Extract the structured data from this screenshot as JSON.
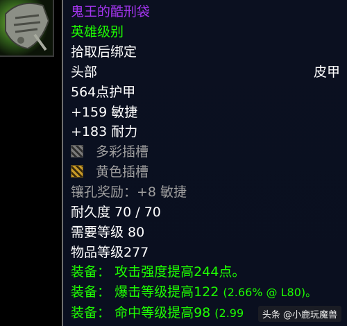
{
  "item": {
    "name": "鬼王的酷刑袋",
    "quality": "英雄级别",
    "bind": "拾取后绑定",
    "slot": "头部",
    "armor_type": "皮甲",
    "armor": "564点护甲",
    "stats": [
      "+159 敏捷",
      "+183 耐力"
    ],
    "sockets": [
      {
        "icon": "prismatic-socket-icon",
        "label": "多彩插槽"
      },
      {
        "icon": "yellow-socket-icon",
        "label": "黄色插槽"
      }
    ],
    "socket_bonus": "镶孔奖励：+8 敏捷",
    "durability": "耐久度 70 / 70",
    "required_level": "需要等级 80",
    "item_level": "物品等级277",
    "equip": [
      {
        "prefix": "装备：",
        "text": "攻击强度提高244点。",
        "extra": ""
      },
      {
        "prefix": "装备：",
        "text": "爆击等级提高122",
        "extra": "(2.66% @ L80)。"
      },
      {
        "prefix": "装备：",
        "text": "命中等级提高98",
        "extra": "(2.99"
      }
    ]
  },
  "watermark": "头条 @小鹿玩魔兽",
  "colors": {
    "epic": "#a335ee",
    "green": "#1eff00",
    "gray": "#9d9d9d",
    "tooltip_bg": "#0b1020"
  }
}
